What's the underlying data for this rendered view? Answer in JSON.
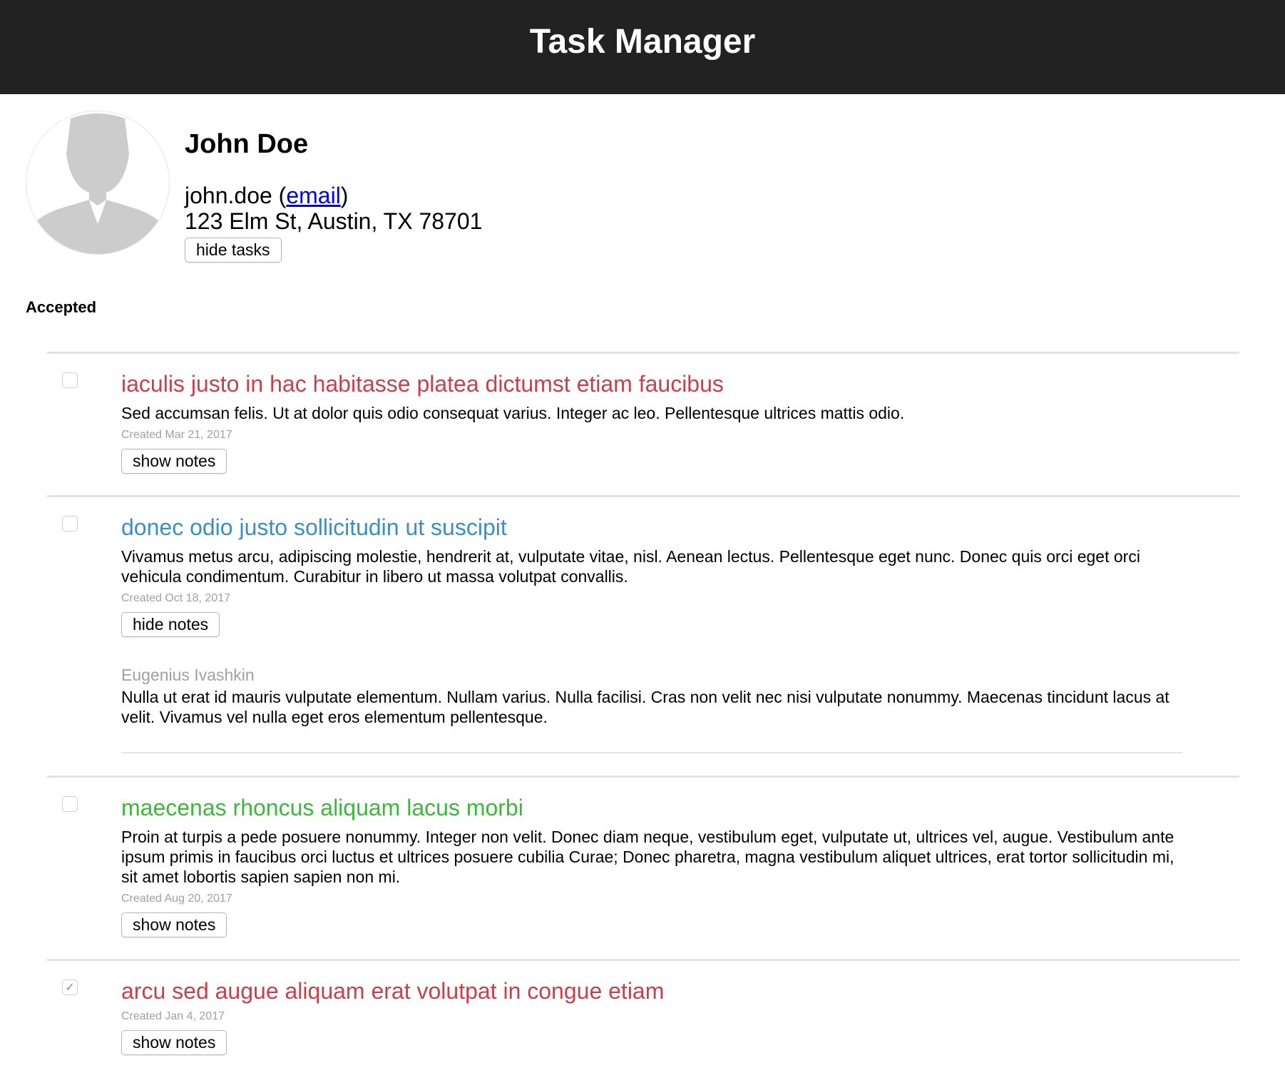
{
  "app": {
    "title": "Task Manager"
  },
  "profile": {
    "name": "John Doe",
    "username": "john.doe",
    "email_label": "email",
    "address": "123 Elm St, Austin, TX 78701",
    "toggle_tasks_label": "hide tasks"
  },
  "sections": {
    "accepted_title": "Accepted"
  },
  "colors": {
    "header_bg": "#222222",
    "title_red": "#c9404b",
    "title_blue": "#3a8fc7",
    "title_green": "#3cb83c"
  },
  "tasks": [
    {
      "checked": false,
      "title": "iaculis justo in hac habitasse platea dictumst etiam faucibus",
      "description": "Sed accumsan felis. Ut at dolor quis odio consequat varius. Integer ac leo. Pellentesque ultrices mattis odio.",
      "created": "Created Mar 21, 2017",
      "notes_button": "show notes"
    },
    {
      "checked": false,
      "title": "donec odio justo sollicitudin ut suscipit",
      "description": "Vivamus metus arcu, adipiscing molestie, hendrerit at, vulputate vitae, nisl. Aenean lectus. Pellentesque eget nunc. Donec quis orci eget orci vehicula condimentum. Curabitur in libero ut massa volutpat convallis.",
      "created": "Created Oct 18, 2017",
      "notes_button": "hide notes",
      "notes": [
        {
          "author": "Eugenius Ivashkin",
          "text": "Nulla ut erat id mauris vulputate elementum. Nullam varius. Nulla facilisi. Cras non velit nec nisi vulputate nonummy. Maecenas tincidunt lacus at velit. Vivamus vel nulla eget eros elementum pellentesque."
        }
      ]
    },
    {
      "checked": false,
      "title": "maecenas rhoncus aliquam lacus morbi",
      "description": "Proin at turpis a pede posuere nonummy. Integer non velit. Donec diam neque, vestibulum eget, vulputate ut, ultrices vel, augue. Vestibulum ante ipsum primis in faucibus orci luctus et ultrices posuere cubilia Curae; Donec pharetra, magna vestibulum aliquet ultrices, erat tortor sollicitudin mi, sit amet lobortis sapien sapien non mi.",
      "created": "Created Aug 20, 2017",
      "notes_button": "show notes"
    },
    {
      "checked": true,
      "checkmark": "✓",
      "title": "arcu sed augue aliquam erat volutpat in congue etiam",
      "created": "Created Jan 4, 2017",
      "notes_button": "show notes"
    }
  ]
}
